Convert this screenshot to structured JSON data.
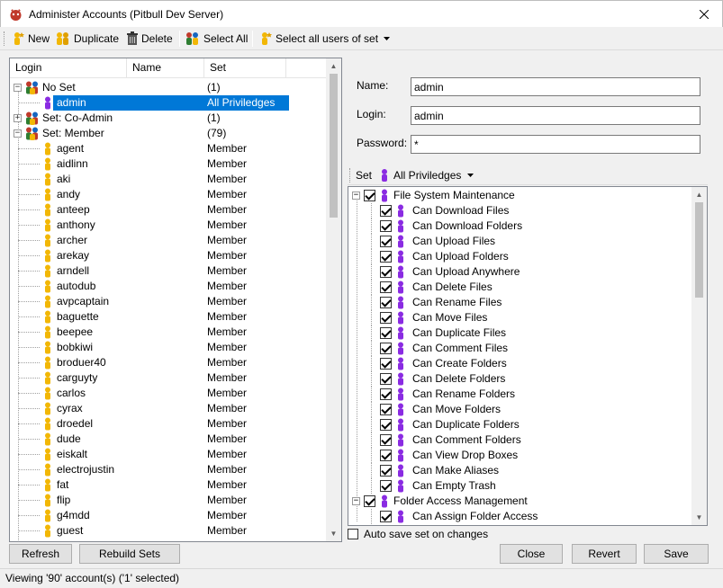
{
  "window": {
    "title": "Administer Accounts (Pitbull Dev Server)"
  },
  "toolbar": {
    "new_label": "New",
    "duplicate_label": "Duplicate",
    "delete_label": "Delete",
    "select_all_label": "Select All",
    "select_set_label": "Select all users of set"
  },
  "list": {
    "columns": [
      "Login",
      "Name",
      "Set"
    ],
    "rows": [
      {
        "login": "No Set",
        "set": "(1)",
        "type": "group",
        "expanded": true
      },
      {
        "login": "admin",
        "set": "All Priviledges",
        "type": "admin",
        "selected": true
      },
      {
        "login": "Set: Co-Admin",
        "set": "(1)",
        "type": "group",
        "expanded": false
      },
      {
        "login": "Set: Member",
        "set": "(79)",
        "type": "group",
        "expanded": true
      },
      {
        "login": "agent",
        "set": "Member",
        "type": "user"
      },
      {
        "login": "aidlinn",
        "set": "Member",
        "type": "user"
      },
      {
        "login": "aki",
        "set": "Member",
        "type": "user"
      },
      {
        "login": "andy",
        "set": "Member",
        "type": "user"
      },
      {
        "login": "anteep",
        "set": "Member",
        "type": "user"
      },
      {
        "login": "anthony",
        "set": "Member",
        "type": "user"
      },
      {
        "login": "archer",
        "set": "Member",
        "type": "user"
      },
      {
        "login": "arekay",
        "set": "Member",
        "type": "user"
      },
      {
        "login": "arndell",
        "set": "Member",
        "type": "user"
      },
      {
        "login": "autodub",
        "set": "Member",
        "type": "user"
      },
      {
        "login": "avpcaptain",
        "set": "Member",
        "type": "user"
      },
      {
        "login": "baguette",
        "set": "Member",
        "type": "user"
      },
      {
        "login": "beepee",
        "set": "Member",
        "type": "user"
      },
      {
        "login": "bobkiwi",
        "set": "Member",
        "type": "user"
      },
      {
        "login": "broduer40",
        "set": "Member",
        "type": "user"
      },
      {
        "login": "carguyty",
        "set": "Member",
        "type": "user"
      },
      {
        "login": "carlos",
        "set": "Member",
        "type": "user"
      },
      {
        "login": "cyrax",
        "set": "Member",
        "type": "user"
      },
      {
        "login": "droedel",
        "set": "Member",
        "type": "user"
      },
      {
        "login": "dude",
        "set": "Member",
        "type": "user"
      },
      {
        "login": "eiskalt",
        "set": "Member",
        "type": "user"
      },
      {
        "login": "electrojustin",
        "set": "Member",
        "type": "user"
      },
      {
        "login": "fat",
        "set": "Member",
        "type": "user"
      },
      {
        "login": "flip",
        "set": "Member",
        "type": "user"
      },
      {
        "login": "g4mdd",
        "set": "Member",
        "type": "user"
      },
      {
        "login": "guest",
        "set": "Member",
        "type": "user"
      }
    ]
  },
  "form": {
    "name_label": "Name:",
    "name_value": "admin",
    "login_label": "Login:",
    "login_value": "admin",
    "password_label": "Password:",
    "password_value": "*"
  },
  "setbar": {
    "label": "Set",
    "value": "All Priviledges"
  },
  "permissions": [
    {
      "label": "File System Maintenance",
      "group": true
    },
    {
      "label": "Can Download Files"
    },
    {
      "label": "Can Download Folders"
    },
    {
      "label": "Can Upload Files"
    },
    {
      "label": "Can Upload Folders"
    },
    {
      "label": "Can Upload Anywhere"
    },
    {
      "label": "Can Delete Files"
    },
    {
      "label": "Can Rename Files"
    },
    {
      "label": "Can Move Files"
    },
    {
      "label": "Can Duplicate Files"
    },
    {
      "label": "Can Comment Files"
    },
    {
      "label": "Can Create Folders"
    },
    {
      "label": "Can Delete Folders"
    },
    {
      "label": "Can Rename Folders"
    },
    {
      "label": "Can Move Folders"
    },
    {
      "label": "Can Duplicate Folders"
    },
    {
      "label": "Can Comment Folders"
    },
    {
      "label": "Can View Drop Boxes"
    },
    {
      "label": "Can Make Aliases"
    },
    {
      "label": "Can Empty Trash"
    },
    {
      "label": "Folder Access Management",
      "group": true
    },
    {
      "label": "Can Assign Folder Access"
    }
  ],
  "auto_save_label": "Auto save set on changes",
  "buttons": {
    "refresh": "Refresh",
    "rebuild": "Rebuild Sets",
    "close": "Close",
    "revert": "Revert",
    "save": "Save"
  },
  "status": "Viewing '90' account(s) ('1' selected)",
  "colors": {
    "selection": "#0078d7",
    "user_icon": "#f2b705",
    "admin_icon": "#8a2be2",
    "group_icon": "#c0392b"
  }
}
